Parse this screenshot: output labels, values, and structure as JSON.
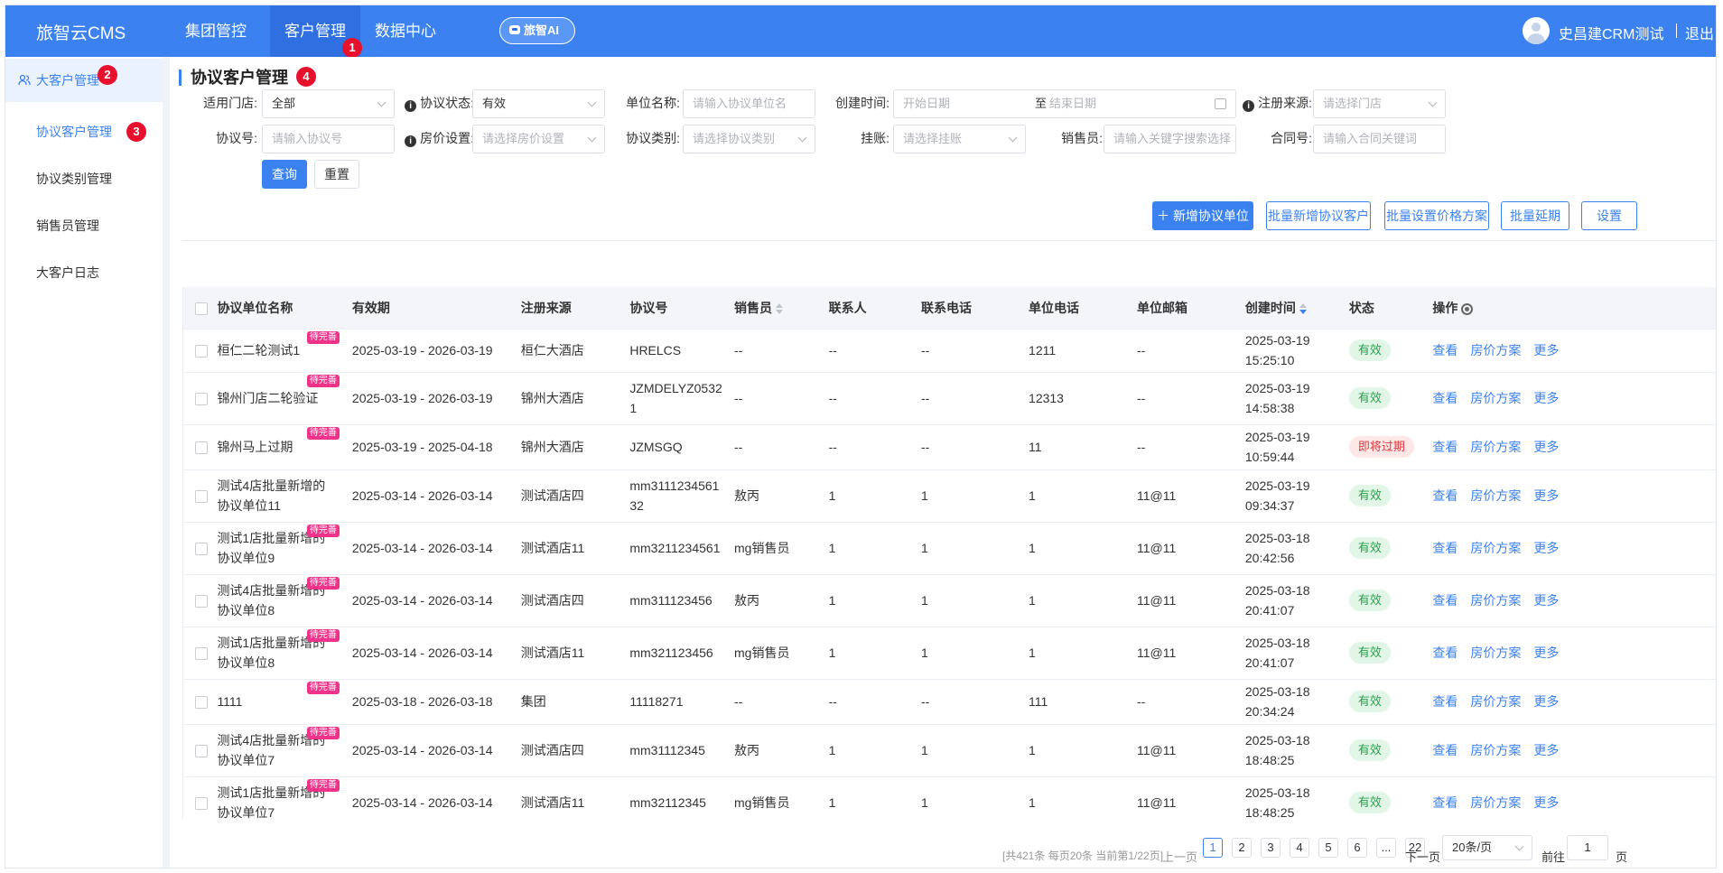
{
  "app": {
    "title": "旅智云CMS"
  },
  "topnav": {
    "items": [
      {
        "label": "集团管控"
      },
      {
        "label": "客户管理"
      },
      {
        "label": "数据中心"
      }
    ],
    "ai_label": "旅智AI",
    "user": "史昌建CRM测试",
    "logout": "退出"
  },
  "badges": [
    "1",
    "2",
    "3",
    "4"
  ],
  "sidebar": {
    "parent": "大客户管理",
    "items": [
      {
        "label": "协议客户管理"
      },
      {
        "label": "协议类别管理"
      },
      {
        "label": "销售员管理"
      },
      {
        "label": "大客户日志"
      }
    ]
  },
  "page": {
    "title": "协议客户管理"
  },
  "filters": {
    "store_label": "适用门店:",
    "store_value": "全部",
    "status_label": "协议状态:",
    "status_value": "有效",
    "unit_label": "单位名称:",
    "unit_placeholder": "请输入协议单位名",
    "created_label": "创建时间:",
    "start_placeholder": "开始日期",
    "range_sep": "至",
    "end_placeholder": "结束日期",
    "source_label": "注册来源:",
    "source_placeholder": "请选择门店",
    "no_label": "协议号:",
    "no_placeholder": "请输入协议号",
    "price_label": "房价设置:",
    "price_placeholder": "请选择房价设置",
    "category_label": "协议类别:",
    "category_placeholder": "请选择协议类别",
    "credit_label": "挂账:",
    "credit_placeholder": "请选择挂账",
    "sales_label": "销售员:",
    "sales_placeholder": "请输入关键字搜索选择",
    "contract_label": "合同号:",
    "contract_placeholder": "请输入合同关键词",
    "query": "查询",
    "reset": "重置"
  },
  "toolbar": {
    "add": "新增协议单位",
    "batch_add": "批量新增协议客户",
    "batch_price": "批量设置价格方案",
    "batch_extend": "批量延期",
    "settings": "设置"
  },
  "table": {
    "headers": {
      "name": "协议单位名称",
      "valid": "有效期",
      "source": "注册来源",
      "no": "协议号",
      "sales": "销售员",
      "contact": "联系人",
      "phone": "联系电话",
      "unit_phone": "单位电话",
      "email": "单位邮箱",
      "created": "创建时间",
      "status": "状态",
      "actions": "操作"
    },
    "tag": "待完善",
    "actions": {
      "view": "查看",
      "price": "房价方案",
      "more": "更多"
    },
    "rows": [
      {
        "name": "桓仁二轮测试1",
        "tagged": true,
        "valid": "2025-03-19 - 2026-03-19",
        "source": "桓仁大酒店",
        "no": "HRELCS",
        "sales": "--",
        "contact": "--",
        "phone": "--",
        "unit_phone": "1211",
        "email": "--",
        "date": "2025-03-19",
        "time": "15:25:10",
        "status": "有效",
        "warn": false
      },
      {
        "name": "锦州门店二轮验证",
        "tagged": true,
        "valid": "2025-03-19 - 2026-03-19",
        "source": "锦州大酒店",
        "no": "JZMDELYZ05321",
        "sales": "--",
        "contact": "--",
        "phone": "--",
        "unit_phone": "12313",
        "email": "--",
        "date": "2025-03-19",
        "time": "14:58:38",
        "status": "有效",
        "warn": false
      },
      {
        "name": "锦州马上过期",
        "tagged": true,
        "valid": "2025-03-19 - 2025-04-18",
        "source": "锦州大酒店",
        "no": "JZMSGQ",
        "sales": "--",
        "contact": "--",
        "phone": "--",
        "unit_phone": "11",
        "email": "--",
        "date": "2025-03-19",
        "time": "10:59:44",
        "status": "即将过期",
        "warn": true
      },
      {
        "name": "测试4店批量新增的协议单位11",
        "tagged": false,
        "valid": "2025-03-14 - 2026-03-14",
        "source": "测试酒店四",
        "no": "mm311123456132",
        "sales": "敖丙",
        "contact": "1",
        "phone": "1",
        "unit_phone": "1",
        "email": "11@11",
        "date": "2025-03-19",
        "time": "09:34:37",
        "status": "有效",
        "warn": false
      },
      {
        "name": "测试1店批量新增的协议单位9",
        "tagged": true,
        "valid": "2025-03-14 - 2026-03-14",
        "source": "测试酒店11",
        "no": "mm3211234561",
        "sales": "mg销售员",
        "contact": "1",
        "phone": "1",
        "unit_phone": "1",
        "email": "11@11",
        "date": "2025-03-18",
        "time": "20:42:56",
        "status": "有效",
        "warn": false
      },
      {
        "name": "测试4店批量新增的协议单位8",
        "tagged": true,
        "valid": "2025-03-14 - 2026-03-14",
        "source": "测试酒店四",
        "no": "mm311123456",
        "sales": "敖丙",
        "contact": "1",
        "phone": "1",
        "unit_phone": "1",
        "email": "11@11",
        "date": "2025-03-18",
        "time": "20:41:07",
        "status": "有效",
        "warn": false
      },
      {
        "name": "测试1店批量新增的协议单位8",
        "tagged": true,
        "valid": "2025-03-14 - 2026-03-14",
        "source": "测试酒店11",
        "no": "mm321123456",
        "sales": "mg销售员",
        "contact": "1",
        "phone": "1",
        "unit_phone": "1",
        "email": "11@11",
        "date": "2025-03-18",
        "time": "20:41:07",
        "status": "有效",
        "warn": false
      },
      {
        "name": "1111",
        "tagged": true,
        "valid": "2025-03-18 - 2026-03-18",
        "source": "集团",
        "no": "11118271",
        "sales": "--",
        "contact": "--",
        "phone": "--",
        "unit_phone": "111",
        "email": "--",
        "date": "2025-03-18",
        "time": "20:34:24",
        "status": "有效",
        "warn": false
      },
      {
        "name": "测试4店批量新增的协议单位7",
        "tagged": true,
        "valid": "2025-03-14 - 2026-03-14",
        "source": "测试酒店四",
        "no": "mm31112345",
        "sales": "敖丙",
        "contact": "1",
        "phone": "1",
        "unit_phone": "1",
        "email": "11@11",
        "date": "2025-03-18",
        "time": "18:48:25",
        "status": "有效",
        "warn": false
      },
      {
        "name": "测试1店批量新增的协议单位7",
        "tagged": true,
        "valid": "2025-03-14 - 2026-03-14",
        "source": "测试酒店11",
        "no": "mm32112345",
        "sales": "mg销售员",
        "contact": "1",
        "phone": "1",
        "unit_phone": "1",
        "email": "11@11",
        "date": "2025-03-18",
        "time": "18:48:25",
        "status": "有效",
        "warn": false
      }
    ]
  },
  "pagination": {
    "summary": "[共421条 每页20条 当前第1/22页]",
    "prev": "上一页",
    "next": "下一页",
    "pages": [
      "1",
      "2",
      "3",
      "4",
      "5",
      "6",
      "...",
      "22"
    ],
    "size": "20条/页",
    "goto": "前往",
    "goto_value": "1",
    "page_suffix": "页"
  }
}
